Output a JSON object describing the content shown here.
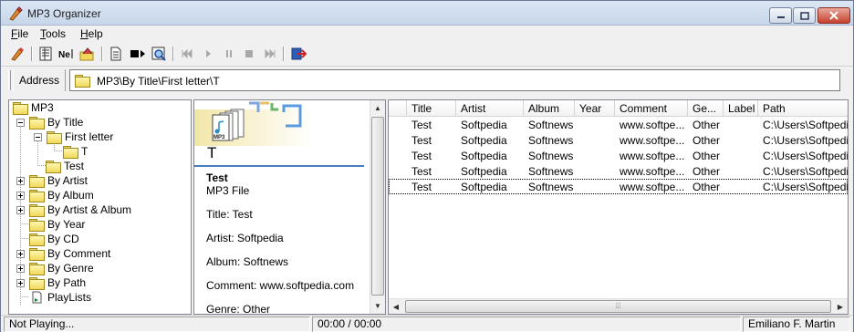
{
  "window": {
    "title": "MP3 Organizer"
  },
  "menu": [
    {
      "label": "File",
      "key": "F",
      "rest": "ile"
    },
    {
      "label": "Tools",
      "key": "T",
      "rest": "ools"
    },
    {
      "label": "Help",
      "key": "H",
      "rest": "elp"
    }
  ],
  "toolbar": {
    "icons": [
      "app-icon",
      "tag-editor-icon",
      "rename-icon",
      "home-folder-icon",
      "document-icon",
      "play-list-icon",
      "search-icon",
      "previous-icon",
      "play-icon",
      "pause-icon",
      "stop-icon",
      "next-icon",
      "exit-icon"
    ]
  },
  "address": {
    "label": "Address",
    "path": "MP3\\By Title\\First letter\\T"
  },
  "tree": {
    "root": "MP3",
    "items": [
      "By Title",
      "First letter",
      "T",
      "Test",
      "By Artist",
      "By Album",
      "By Artist & Album",
      "By Year",
      "By CD",
      "By Comment",
      "By Genre",
      "By Path",
      "PlayLists"
    ]
  },
  "info": {
    "folder_title": "T",
    "file_title": "Test",
    "file_type": "MP3 File",
    "lines": [
      "Title: Test",
      "Artist: Softpedia",
      "Album: Softnews",
      "Comment: www.softpedia.com",
      "Genre: Other"
    ],
    "thumb_text": "MP3"
  },
  "list": {
    "columns": [
      "Title",
      "Artist",
      "Album",
      "Year",
      "Comment",
      "Ge...",
      "Label",
      "Path"
    ],
    "rows": [
      [
        "Test",
        "Softpedia",
        "Softnews",
        "",
        "www.softpe...",
        "Other",
        "",
        "C:\\Users\\Softpedia"
      ],
      [
        "Test",
        "Softpedia",
        "Softnews",
        "",
        "www.softpe...",
        "Other",
        "",
        "C:\\Users\\Softpedia"
      ],
      [
        "Test",
        "Softpedia",
        "Softnews",
        "",
        "www.softpe...",
        "Other",
        "",
        "C:\\Users\\Softpedia"
      ],
      [
        "Test",
        "Softpedia",
        "Softnews",
        "",
        "www.softpe...",
        "Other",
        "",
        "C:\\Users\\Softpedia"
      ],
      [
        "Test",
        "Softpedia",
        "Softnews",
        "",
        "www.softpe...",
        "Other",
        "",
        "C:\\Users\\Softpedia"
      ]
    ]
  },
  "status": {
    "playing": "Not Playing...",
    "time": "00:00 / 00:00",
    "author": "Emiliano F. Martin"
  },
  "colors": {
    "accent": "#4c7cc0",
    "title_bar": "#c7d6ea",
    "close_button": "#c6412c"
  }
}
